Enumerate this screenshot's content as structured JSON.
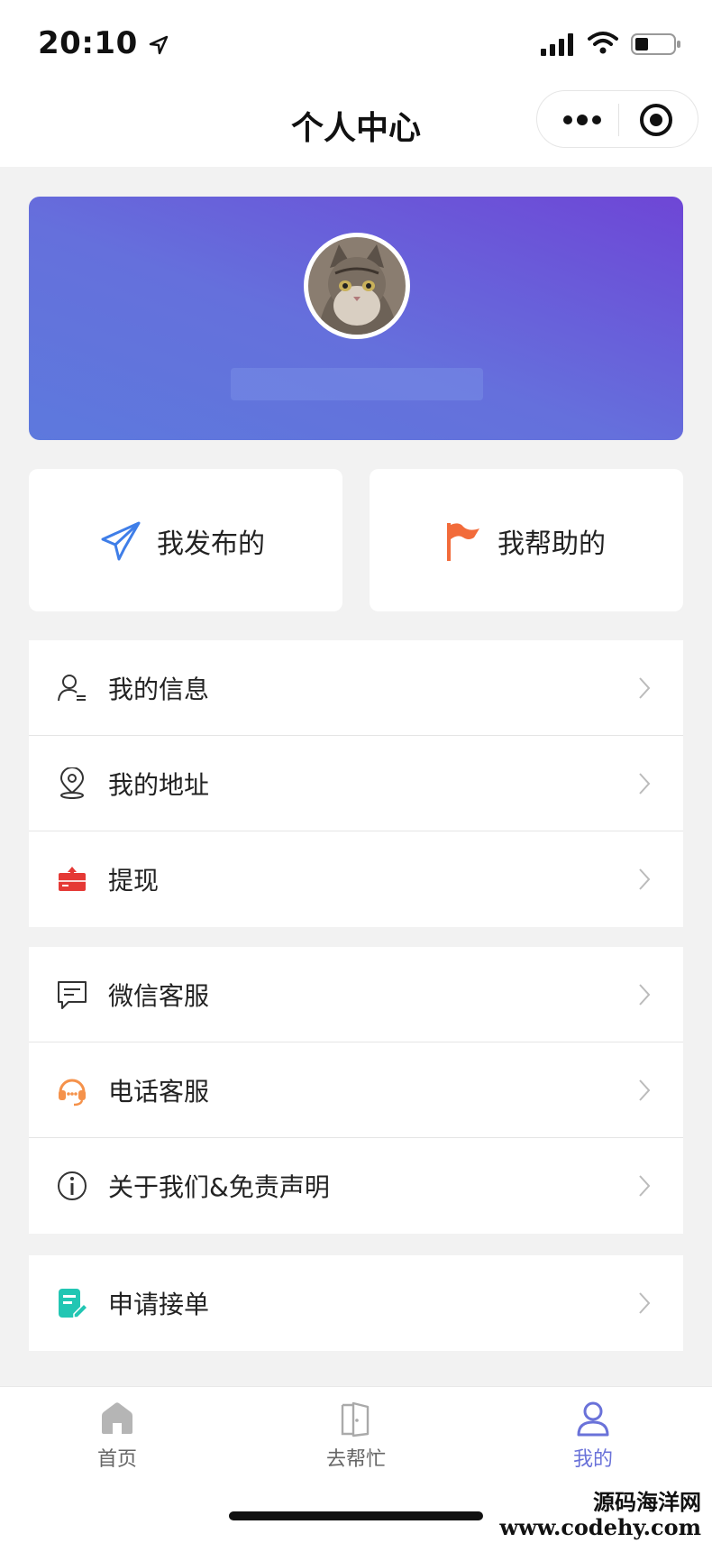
{
  "status": {
    "time": "20:10"
  },
  "nav": {
    "title": "个人中心"
  },
  "hero": {
    "avatar": "cat-avatar"
  },
  "quick_actions": [
    {
      "label": "我发布的",
      "icon": "paper-plane-icon",
      "color": "#3f7ee8"
    },
    {
      "label": "我帮助的",
      "icon": "flag-icon",
      "color": "#f26b3a"
    }
  ],
  "menu": {
    "group1": [
      {
        "label": "我的信息",
        "icon": "user-info-icon"
      },
      {
        "label": "我的地址",
        "icon": "location-pin-icon"
      },
      {
        "label": "提现",
        "icon": "withdraw-wallet-icon"
      }
    ],
    "group2": [
      {
        "label": "微信客服",
        "icon": "chat-bubble-icon"
      },
      {
        "label": "电话客服",
        "icon": "headset-icon"
      },
      {
        "label": "关于我们&免责声明",
        "icon": "info-circle-icon"
      }
    ],
    "group3": [
      {
        "label": "申请接单",
        "icon": "edit-form-icon"
      }
    ]
  },
  "tabs": [
    {
      "label": "首页",
      "icon": "home-icon",
      "active": false
    },
    {
      "label": "去帮忙",
      "icon": "door-icon",
      "active": false
    },
    {
      "label": "我的",
      "icon": "user-icon",
      "active": true
    }
  ],
  "watermark": {
    "line1": "源码海洋网",
    "line2": "www.codehy.com"
  },
  "colors": {
    "accent": "#6a72d9",
    "hero_start": "#5d79dd",
    "hero_end": "#6e46d6"
  }
}
